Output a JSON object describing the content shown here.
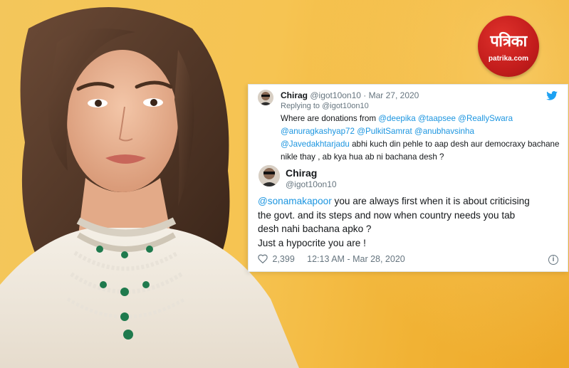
{
  "logo": {
    "hindi": "पत्रिका",
    "site": "patrika.com"
  },
  "tweet": {
    "quoted": {
      "name": "Chirag",
      "handle": "@igot10on10",
      "date": "Mar 27, 2020",
      "replying_to": "Replying to @igot10on10",
      "text_prefix": "Where are donations from",
      "mentions": [
        "@deepika",
        "@taapsee",
        "@ReallySwara",
        "@anuragkashyap72",
        "@PulkitSamrat",
        "@anubhavsinha",
        "@Javedakhtarjadu"
      ],
      "text_rest": "abhi kuch din pehle to aap desh aur democraxy bachane nikle thay , ab kya hua ab ni bachana desh ?"
    },
    "main": {
      "name": "Chirag",
      "handle": "@igot10on10",
      "mention": "@sonamakapoor",
      "text_line1": "you are always  first when it is about criticising",
      "text_line2": "the govt. and its steps and now when country needs you tab",
      "text_line3": "desh nahi bachana apko ?",
      "text_line4": "Just a hypocrite  you are !"
    },
    "footer": {
      "likes": "2,399",
      "timestamp": "12:13 AM - Mar 28, 2020",
      "info_glyph": "i"
    }
  },
  "colors": {
    "background": "#f2b73c",
    "logo_red": "#c31d1c",
    "link_blue": "#1b95e0",
    "twitter_blue": "#1da1f2"
  }
}
